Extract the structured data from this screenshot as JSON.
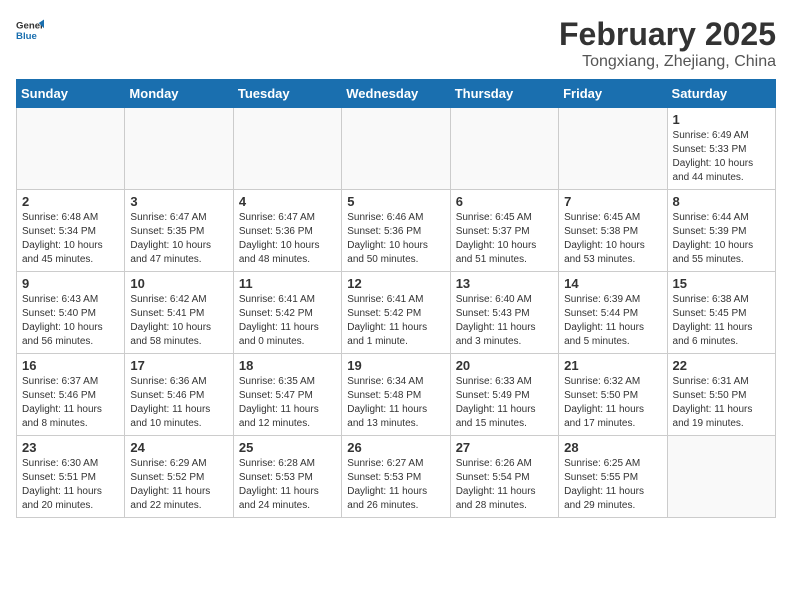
{
  "header": {
    "logo_general": "General",
    "logo_blue": "Blue",
    "title": "February 2025",
    "subtitle": "Tongxiang, Zhejiang, China"
  },
  "weekdays": [
    "Sunday",
    "Monday",
    "Tuesday",
    "Wednesday",
    "Thursday",
    "Friday",
    "Saturday"
  ],
  "weeks": [
    [
      {
        "day": "",
        "info": ""
      },
      {
        "day": "",
        "info": ""
      },
      {
        "day": "",
        "info": ""
      },
      {
        "day": "",
        "info": ""
      },
      {
        "day": "",
        "info": ""
      },
      {
        "day": "",
        "info": ""
      },
      {
        "day": "1",
        "info": "Sunrise: 6:49 AM\nSunset: 5:33 PM\nDaylight: 10 hours and 44 minutes."
      }
    ],
    [
      {
        "day": "2",
        "info": "Sunrise: 6:48 AM\nSunset: 5:34 PM\nDaylight: 10 hours and 45 minutes."
      },
      {
        "day": "3",
        "info": "Sunrise: 6:47 AM\nSunset: 5:35 PM\nDaylight: 10 hours and 47 minutes."
      },
      {
        "day": "4",
        "info": "Sunrise: 6:47 AM\nSunset: 5:36 PM\nDaylight: 10 hours and 48 minutes."
      },
      {
        "day": "5",
        "info": "Sunrise: 6:46 AM\nSunset: 5:36 PM\nDaylight: 10 hours and 50 minutes."
      },
      {
        "day": "6",
        "info": "Sunrise: 6:45 AM\nSunset: 5:37 PM\nDaylight: 10 hours and 51 minutes."
      },
      {
        "day": "7",
        "info": "Sunrise: 6:45 AM\nSunset: 5:38 PM\nDaylight: 10 hours and 53 minutes."
      },
      {
        "day": "8",
        "info": "Sunrise: 6:44 AM\nSunset: 5:39 PM\nDaylight: 10 hours and 55 minutes."
      }
    ],
    [
      {
        "day": "9",
        "info": "Sunrise: 6:43 AM\nSunset: 5:40 PM\nDaylight: 10 hours and 56 minutes."
      },
      {
        "day": "10",
        "info": "Sunrise: 6:42 AM\nSunset: 5:41 PM\nDaylight: 10 hours and 58 minutes."
      },
      {
        "day": "11",
        "info": "Sunrise: 6:41 AM\nSunset: 5:42 PM\nDaylight: 11 hours and 0 minutes."
      },
      {
        "day": "12",
        "info": "Sunrise: 6:41 AM\nSunset: 5:42 PM\nDaylight: 11 hours and 1 minute."
      },
      {
        "day": "13",
        "info": "Sunrise: 6:40 AM\nSunset: 5:43 PM\nDaylight: 11 hours and 3 minutes."
      },
      {
        "day": "14",
        "info": "Sunrise: 6:39 AM\nSunset: 5:44 PM\nDaylight: 11 hours and 5 minutes."
      },
      {
        "day": "15",
        "info": "Sunrise: 6:38 AM\nSunset: 5:45 PM\nDaylight: 11 hours and 6 minutes."
      }
    ],
    [
      {
        "day": "16",
        "info": "Sunrise: 6:37 AM\nSunset: 5:46 PM\nDaylight: 11 hours and 8 minutes."
      },
      {
        "day": "17",
        "info": "Sunrise: 6:36 AM\nSunset: 5:46 PM\nDaylight: 11 hours and 10 minutes."
      },
      {
        "day": "18",
        "info": "Sunrise: 6:35 AM\nSunset: 5:47 PM\nDaylight: 11 hours and 12 minutes."
      },
      {
        "day": "19",
        "info": "Sunrise: 6:34 AM\nSunset: 5:48 PM\nDaylight: 11 hours and 13 minutes."
      },
      {
        "day": "20",
        "info": "Sunrise: 6:33 AM\nSunset: 5:49 PM\nDaylight: 11 hours and 15 minutes."
      },
      {
        "day": "21",
        "info": "Sunrise: 6:32 AM\nSunset: 5:50 PM\nDaylight: 11 hours and 17 minutes."
      },
      {
        "day": "22",
        "info": "Sunrise: 6:31 AM\nSunset: 5:50 PM\nDaylight: 11 hours and 19 minutes."
      }
    ],
    [
      {
        "day": "23",
        "info": "Sunrise: 6:30 AM\nSunset: 5:51 PM\nDaylight: 11 hours and 20 minutes."
      },
      {
        "day": "24",
        "info": "Sunrise: 6:29 AM\nSunset: 5:52 PM\nDaylight: 11 hours and 22 minutes."
      },
      {
        "day": "25",
        "info": "Sunrise: 6:28 AM\nSunset: 5:53 PM\nDaylight: 11 hours and 24 minutes."
      },
      {
        "day": "26",
        "info": "Sunrise: 6:27 AM\nSunset: 5:53 PM\nDaylight: 11 hours and 26 minutes."
      },
      {
        "day": "27",
        "info": "Sunrise: 6:26 AM\nSunset: 5:54 PM\nDaylight: 11 hours and 28 minutes."
      },
      {
        "day": "28",
        "info": "Sunrise: 6:25 AM\nSunset: 5:55 PM\nDaylight: 11 hours and 29 minutes."
      },
      {
        "day": "",
        "info": ""
      }
    ]
  ]
}
